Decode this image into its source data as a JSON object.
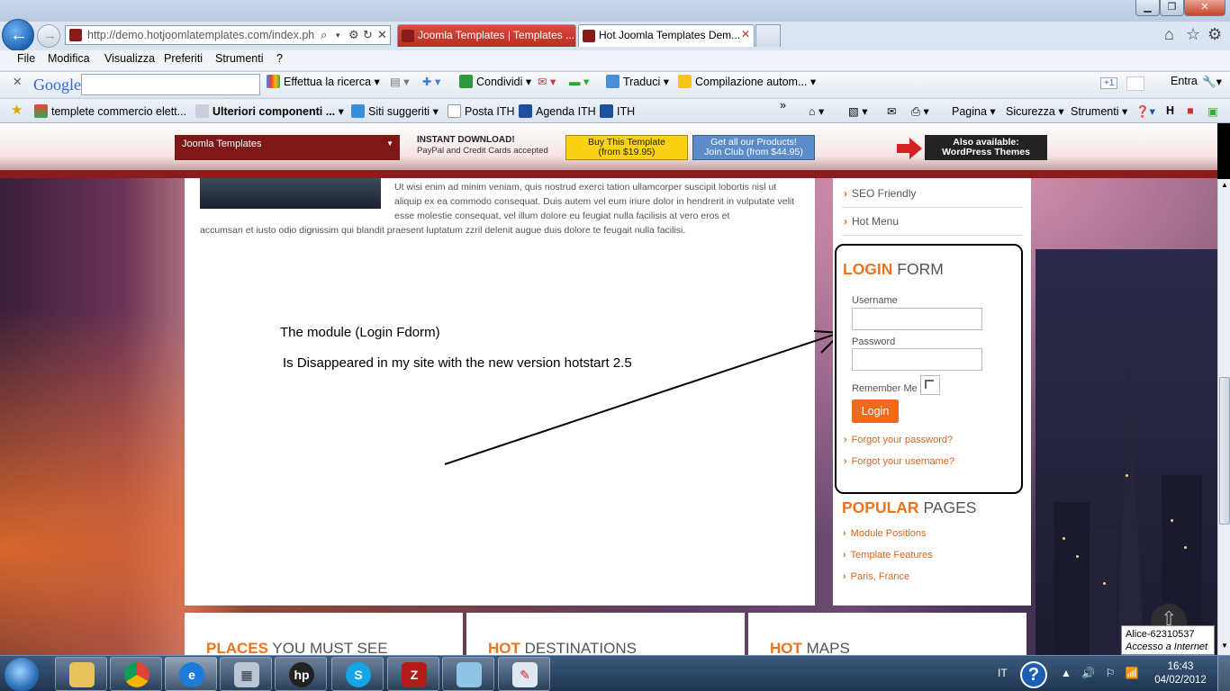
{
  "window": {
    "minimize": "▁",
    "maximize": "❐",
    "close": "✕"
  },
  "nav": {
    "back_icon": "back-arrow-icon",
    "forward_icon": "forward-arrow-icon"
  },
  "address": {
    "url": "http://demo.hotjoomlatemplates.com/index.ph",
    "controls": [
      "⌕",
      "▾",
      "⚙",
      "↻",
      "✕"
    ]
  },
  "tabs": [
    {
      "label": "Joomla Templates | Templates ..."
    },
    {
      "label": "Hot Joomla Templates Dem...",
      "close": "✕"
    }
  ],
  "browser_right_icons": {
    "home": "⌂",
    "star": "☆",
    "gear": "⚙"
  },
  "menu": [
    "File",
    "Modifica",
    "Visualizza",
    "Preferiti",
    "Strumenti",
    "?"
  ],
  "google_bar": {
    "logo": "Google",
    "search_btn": "Effettua la ricerca",
    "share": "Condividi",
    "translate": "Traduci",
    "autofill": "Compilazione autom...",
    "plus": "+1",
    "signin": "Entra"
  },
  "favorites": {
    "items": [
      "templete commercio elett...",
      "Ulteriori componenti ...",
      "Siti suggeriti",
      "Posta ITH",
      "Agenda ITH",
      "ITH"
    ],
    "more": "»",
    "commands": [
      "Pagina",
      "Sicurezza",
      "Strumenti"
    ]
  },
  "site_top": {
    "template_select": "Joomla Templates",
    "instant_title": "INSTANT DOWNLOAD!",
    "instant_sub": "PayPal and Credit Cards accepted",
    "buy_line1": "Buy This Template",
    "buy_line2": "(from $19.95)",
    "club_line1": "Get all our Products!",
    "club_line2": "Join Club (from $44.95)",
    "wp_line1": "Also available:",
    "wp_line2": "WordPress Themes"
  },
  "content": {
    "para1": "Ut wisi enim ad minim veniam, quis nostrud exerci tation ullamcorper suscipit lobortis nisl ut aliquip ex ea commodo consequat. Duis autem vel eum iriure dolor in hendrerit in vulputate velit esse molestie consequat, vel illum dolore eu feugiat nulla facilisis at vero eros et",
    "para2": "accumsan et iusto odio dignissim qui blandit praesent luptatum zzril delenit augue duis dolore te feugait nulla facilisi.",
    "note1": "The module (Login Fdorm)",
    "note2": "Is Disappeared in my site with the new version hotstart 2.5"
  },
  "sidebar": {
    "links": [
      "SEO Friendly",
      "Hot Menu"
    ],
    "login_title_accent": "LOGIN",
    "login_title_rest": "FORM",
    "username_label": "Username",
    "password_label": "Password",
    "remember_label": "Remember Me",
    "login_btn": "Login",
    "forgot_password": "Forgot your password?",
    "forgot_username": "Forgot your username?",
    "popular_accent": "POPULAR",
    "popular_rest": "PAGES",
    "popular_links": [
      "Module Positions",
      "Template Features",
      "Paris, France"
    ]
  },
  "bottom": [
    {
      "accent": "PLACES",
      "rest": "YOU MUST SEE"
    },
    {
      "accent": "HOT",
      "rest": "DESTINATIONS"
    },
    {
      "accent": "HOT",
      "rest": "MAPS"
    }
  ],
  "tooltip": {
    "line1": "Alice-62310537",
    "line2": "Accesso a Internet"
  },
  "taskbar": {
    "apps": [
      "explorer",
      "chrome",
      "internet-explorer",
      "calculator",
      "hp",
      "skype",
      "filezilla",
      "notepad",
      "paint"
    ],
    "lang": "IT",
    "tray_icons": "▲ 🔊 ⚐ 📶",
    "time": "16:43",
    "date": "04/02/2012"
  },
  "colors": {
    "accent": "#f0731a",
    "brand_red": "#8b1c1c",
    "buy": "#f9d214",
    "club": "#5b8cc9"
  }
}
